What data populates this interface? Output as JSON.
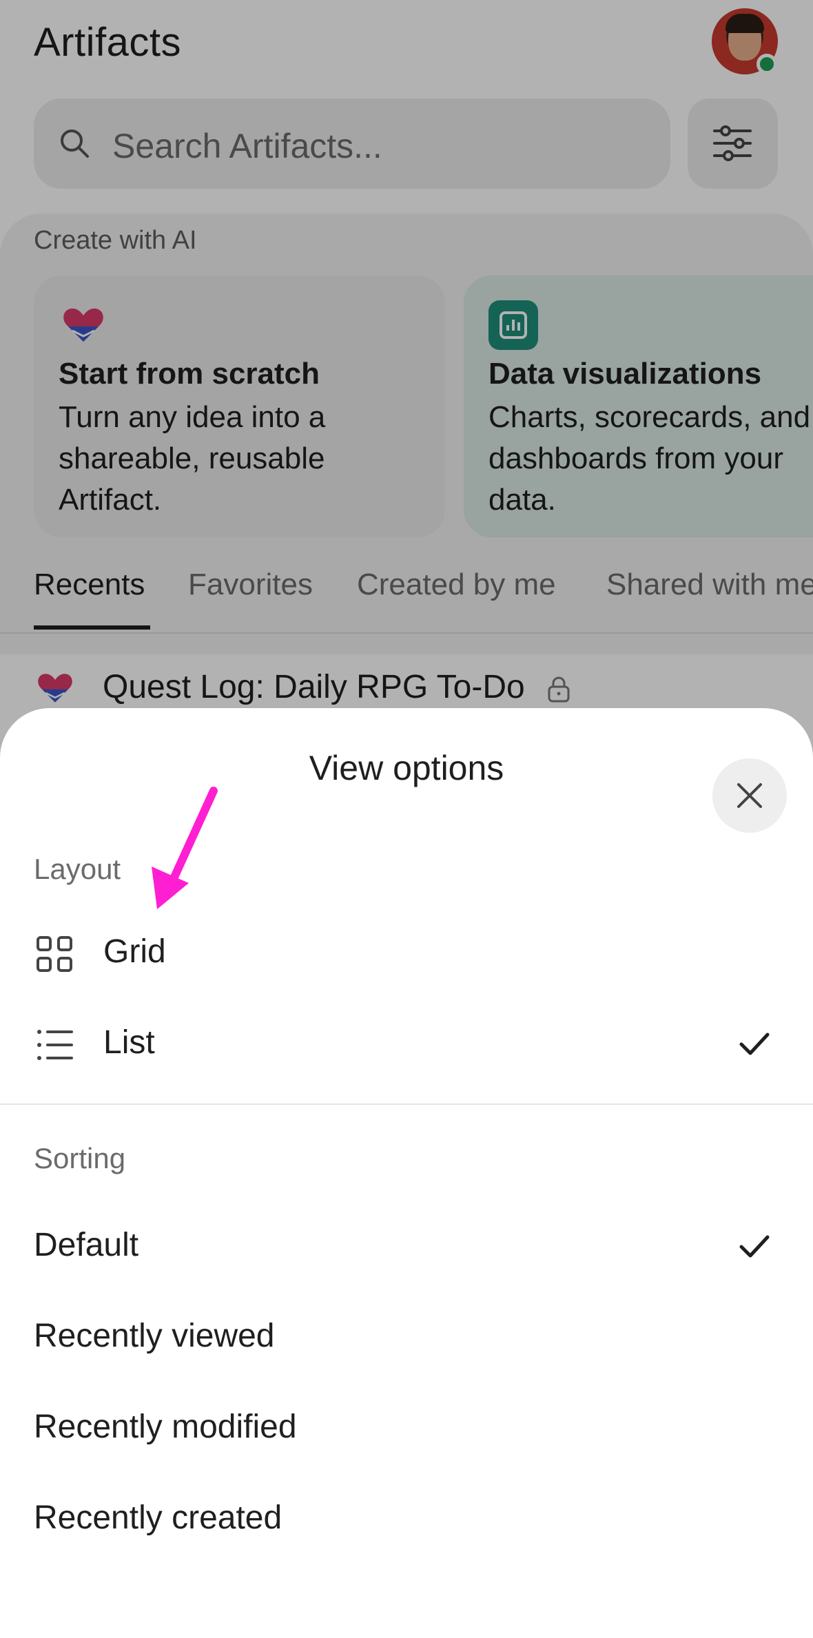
{
  "header": {
    "title": "Artifacts",
    "search_placeholder": "Search Artifacts..."
  },
  "create_with_ai": {
    "label": "Create with AI",
    "cards": [
      {
        "title": "Start from scratch",
        "desc": [
          "Turn any idea into a",
          "shareable, reusable",
          "Artifact."
        ]
      },
      {
        "title": "Data visualizations",
        "desc": [
          "Charts, scorecards, and",
          "dashboards from your",
          "data."
        ]
      }
    ]
  },
  "tabs": [
    "Recents",
    "Favorites",
    "Created by me",
    "Shared with me"
  ],
  "recent_item": {
    "title": "Quest Log: Daily RPG To-Do"
  },
  "sheet": {
    "title": "View options",
    "layout_label": "Layout",
    "layout_options": [
      {
        "label": "Grid",
        "selected": false
      },
      {
        "label": "List",
        "selected": true
      }
    ],
    "sorting_label": "Sorting",
    "sorting_options": [
      {
        "label": "Default",
        "selected": true
      },
      {
        "label": "Recently viewed",
        "selected": false
      },
      {
        "label": "Recently modified",
        "selected": false
      },
      {
        "label": "Recently created",
        "selected": false
      }
    ]
  },
  "colors": {
    "accent_teal": "#1e8f7a",
    "annotation_arrow": "#ff1fd2",
    "status_online": "#1f9d55"
  }
}
